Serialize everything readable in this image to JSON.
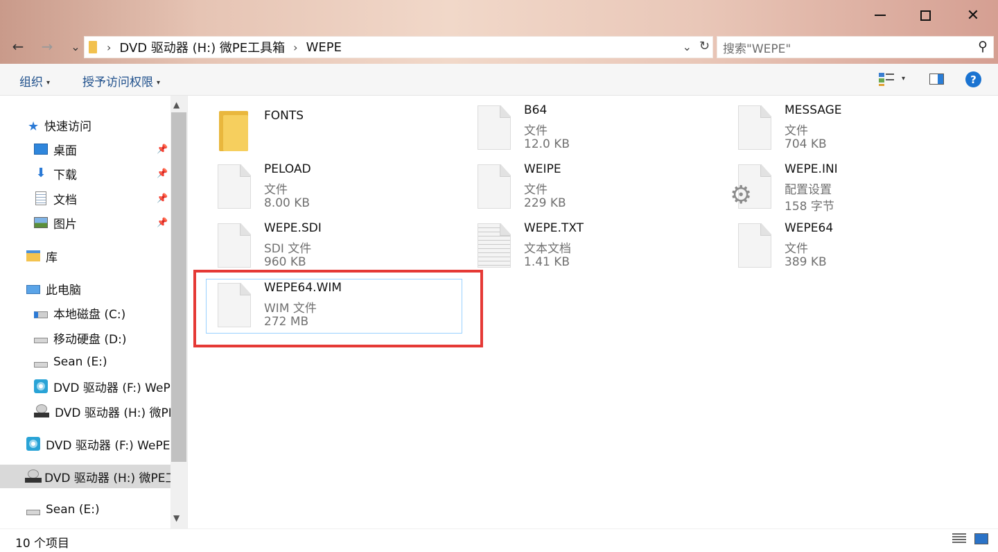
{
  "window": {
    "minimize_glyph": "—",
    "close_glyph": "✕"
  },
  "nav": {
    "back": "←",
    "forward": "→",
    "recent": "⌄"
  },
  "address": {
    "crumbs": [
      "DVD 驱动器 (H:) 微PE工具箱",
      "WEPE"
    ],
    "separator": "›",
    "dropdown": "⌄",
    "refresh": "↻"
  },
  "search": {
    "placeholder": "搜索\"WEPE\"",
    "icon": "⚲"
  },
  "ribbon": {
    "organize": "组织",
    "share": "授予访问权限",
    "caret": "▾",
    "help": "?"
  },
  "sidebar": {
    "pin_glyph": "📌",
    "items": [
      {
        "label": "快速访问"
      },
      {
        "label": "桌面"
      },
      {
        "label": "下载"
      },
      {
        "label": "文档"
      },
      {
        "label": "图片"
      },
      {
        "label": "库"
      },
      {
        "label": "此电脑"
      },
      {
        "label": "本地磁盘 (C:)"
      },
      {
        "label": "移动硬盘 (D:)"
      },
      {
        "label": "Sean (E:)"
      },
      {
        "label": "DVD 驱动器 (F:) WePE"
      },
      {
        "label": "DVD 驱动器 (H:) 微PE工具箱"
      },
      {
        "label": "DVD 驱动器 (F:) WePE"
      },
      {
        "label": "DVD 驱动器 (H:) 微PE工具箱"
      },
      {
        "label": "Sean (E:)"
      }
    ],
    "scroll_up": "▲",
    "scroll_down": "▼"
  },
  "files": [
    {
      "name": "FONTS",
      "type": "",
      "size": "",
      "icon": "folder-icon"
    },
    {
      "name": "B64",
      "type": "文件",
      "size": "12.0 KB",
      "icon": "file-icon"
    },
    {
      "name": "MESSAGE",
      "type": "文件",
      "size": "704 KB",
      "icon": "file-icon"
    },
    {
      "name": "PELOAD",
      "type": "文件",
      "size": "8.00 KB",
      "icon": "file-icon"
    },
    {
      "name": "WEIPE",
      "type": "文件",
      "size": "229 KB",
      "icon": "file-icon"
    },
    {
      "name": "WEPE.INI",
      "type": "配置设置",
      "size": "158 字节",
      "icon": "config-file-icon"
    },
    {
      "name": "WEPE.SDI",
      "type": "SDI 文件",
      "size": "960 KB",
      "icon": "file-icon"
    },
    {
      "name": "WEPE.TXT",
      "type": "文本文档",
      "size": "1.41 KB",
      "icon": "text-file-icon"
    },
    {
      "name": "WEPE64",
      "type": "文件",
      "size": "389 KB",
      "icon": "file-icon"
    },
    {
      "name": "WEPE64.WIM",
      "type": "WIM 文件",
      "size": "272 MB",
      "icon": "file-icon"
    }
  ],
  "status": {
    "item_count": "10 个项目"
  },
  "colors": {
    "accent": "#1a73d1",
    "highlight_box": "#e53935",
    "selection_border": "#99d1ff",
    "folder": "#f6cf5e"
  }
}
